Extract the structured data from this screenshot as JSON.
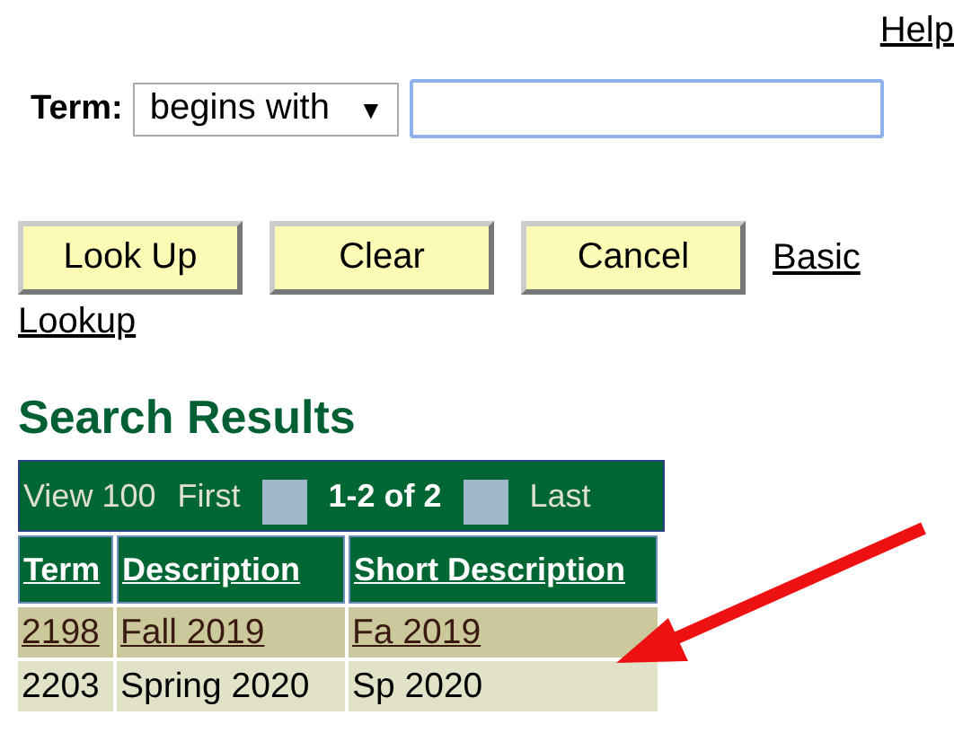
{
  "help_link": "Help",
  "search": {
    "field_label": "Term:",
    "operator": "begins with",
    "operator_arrow": "▼"
  },
  "buttons": [
    "Look Up",
    "Clear",
    "Cancel"
  ],
  "basic_lookup_link": {
    "line_1": "Basic",
    "line_2": "Lookup"
  },
  "results": {
    "title": "Search Results",
    "nav": {
      "view": "View 100",
      "first": "First",
      "range": "1-2 of 2",
      "last": "Last"
    },
    "columns": [
      "Term",
      "Description",
      "Short Description"
    ],
    "rows": [
      {
        "cells": [
          "2198",
          "Fall 2019",
          "Fa 2019"
        ],
        "selected": true
      },
      {
        "cells": [
          "2203",
          "Spring 2020",
          "Sp 2020"
        ],
        "selected": false
      }
    ]
  },
  "annotation": {
    "kind": "arrow"
  }
}
